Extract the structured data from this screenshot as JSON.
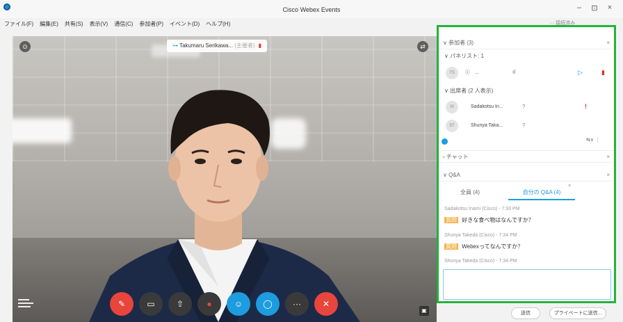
{
  "window": {
    "title": "Cisco Webex Events",
    "minimize": "–",
    "maximize": "⊡",
    "close": "×",
    "extra_label": "··· 接続済み"
  },
  "menu": [
    "ファイル(F)",
    "編集(E)",
    "共有(S)",
    "表示(V)",
    "通信(C)",
    "参加者(P)",
    "イベント(D)",
    "ヘルプ(H)"
  ],
  "video": {
    "speaker_name": "Takumaru Serikawa...",
    "speaker_suffix": "(主催者)",
    "top_left_icon": "dots-icon",
    "top_right_icon": "layout-icon"
  },
  "controls": [
    {
      "name": "mute-button",
      "glyph": "⏚",
      "style": "red"
    },
    {
      "name": "video-button",
      "glyph": "▭",
      "style": "dark"
    },
    {
      "name": "share-button",
      "glyph": "⇪",
      "style": "dark"
    },
    {
      "name": "record-button",
      "glyph": "◉",
      "style": "dark"
    },
    {
      "name": "participants-button",
      "glyph": "☺",
      "style": "blue"
    },
    {
      "name": "chat-button",
      "glyph": "◯",
      "style": "blue"
    },
    {
      "name": "more-button",
      "glyph": "···",
      "style": "dark"
    },
    {
      "name": "leave-button",
      "glyph": "✕",
      "style": "red"
    }
  ],
  "panel": {
    "participants_header": "参加者 (3)",
    "panelists_header": "パネリスト: 1",
    "panelist": {
      "initials": "TS",
      "name": "..."
    },
    "attendees_header": "出席者 (2 人表示)",
    "attendees": [
      {
        "initials": "SI",
        "name": "Sadakotsu In...",
        "q": "?",
        "flag": "!"
      },
      {
        "initials": "ST",
        "name": "Shunya Taka...",
        "q": "?",
        "flag": ""
      }
    ],
    "chat_header": "チャット",
    "qa_header": "Q&A",
    "tabs": [
      {
        "label": "全員 (4)"
      },
      {
        "label": "自分の Q&A (4)"
      }
    ],
    "questions": [
      {
        "meta": "Sadakotsu Inami (Cisco) - 7:33 PM",
        "tag": "質問",
        "text": "好きな食べ物はなんですか？"
      },
      {
        "meta": "Shunya Takeda (Cisco) - 7:34 PM",
        "tag": "質問",
        "text": "Webexってなんですか？"
      },
      {
        "meta": "Shunya Takeda (Cisco) - 7:34 PM",
        "tag": "",
        "text": ""
      }
    ],
    "send_label": "送信",
    "private_send_label": "プライベートに送信..."
  }
}
